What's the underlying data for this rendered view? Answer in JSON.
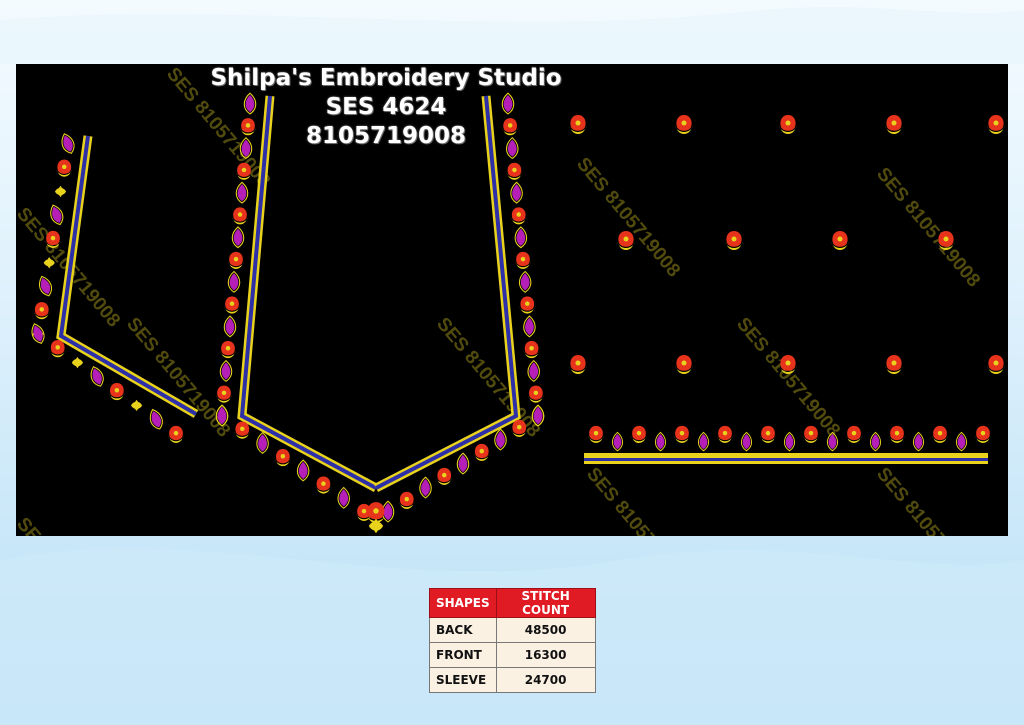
{
  "studio": {
    "name": "Shilpa's Embroidery Studio",
    "code": "SES 4624",
    "phone": "8105719008"
  },
  "watermark": "SES 8105719008",
  "table": {
    "headers": [
      "SHAPES",
      "STITCH COUNT"
    ],
    "rows": [
      {
        "shape": "BACK",
        "count": "48500"
      },
      {
        "shape": "FRONT",
        "count": "16300"
      },
      {
        "shape": "SLEEVE",
        "count": "24700"
      }
    ]
  },
  "colors": {
    "panel": "#000000",
    "gold": "#e8d21c",
    "magenta": "#b51fb8",
    "red": "#e8331c",
    "blue": "#2d2fa8",
    "header_red": "#e01b24"
  }
}
